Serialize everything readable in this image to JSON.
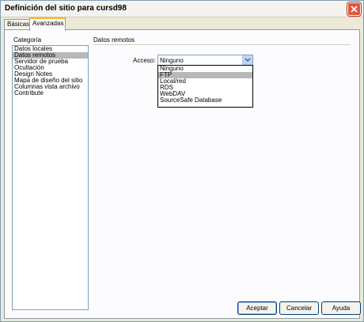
{
  "window": {
    "title": "Definición del sitio para cursd98"
  },
  "tabs": [
    {
      "label": "Básicas",
      "active": false
    },
    {
      "label": "Avanzadas",
      "active": true
    }
  ],
  "category": {
    "label": "Categoría",
    "items": [
      {
        "label": "Datos locales"
      },
      {
        "label": "Datos remotos",
        "selected": true
      },
      {
        "label": "Servidor de prueba"
      },
      {
        "label": "Ocultación"
      },
      {
        "label": "Design Notes"
      },
      {
        "label": "Mapa de diseño del sitio"
      },
      {
        "label": "Columnas vista archivo"
      },
      {
        "label": "Contribute"
      }
    ]
  },
  "main": {
    "section_title": "Datos remotos",
    "access_label": "Acceso:",
    "access_value": "Ninguno",
    "access_options": [
      {
        "label": "Ninguno"
      },
      {
        "label": "FTP",
        "hover": true
      },
      {
        "label": "Local/red"
      },
      {
        "label": "RDS"
      },
      {
        "label": "WebDAV"
      },
      {
        "label": "SourceSafe Database"
      }
    ]
  },
  "buttons": {
    "ok": "Aceptar",
    "cancel": "Cancelar",
    "help": "Ayuda"
  },
  "icons": {
    "close": "close-icon",
    "dropdown": "chevron-down-icon"
  },
  "colors": {
    "close_button": "#e0563c",
    "active_tab_accent": "#f5b731",
    "selection": "#b8b8b8",
    "border": "#7f9db9"
  }
}
